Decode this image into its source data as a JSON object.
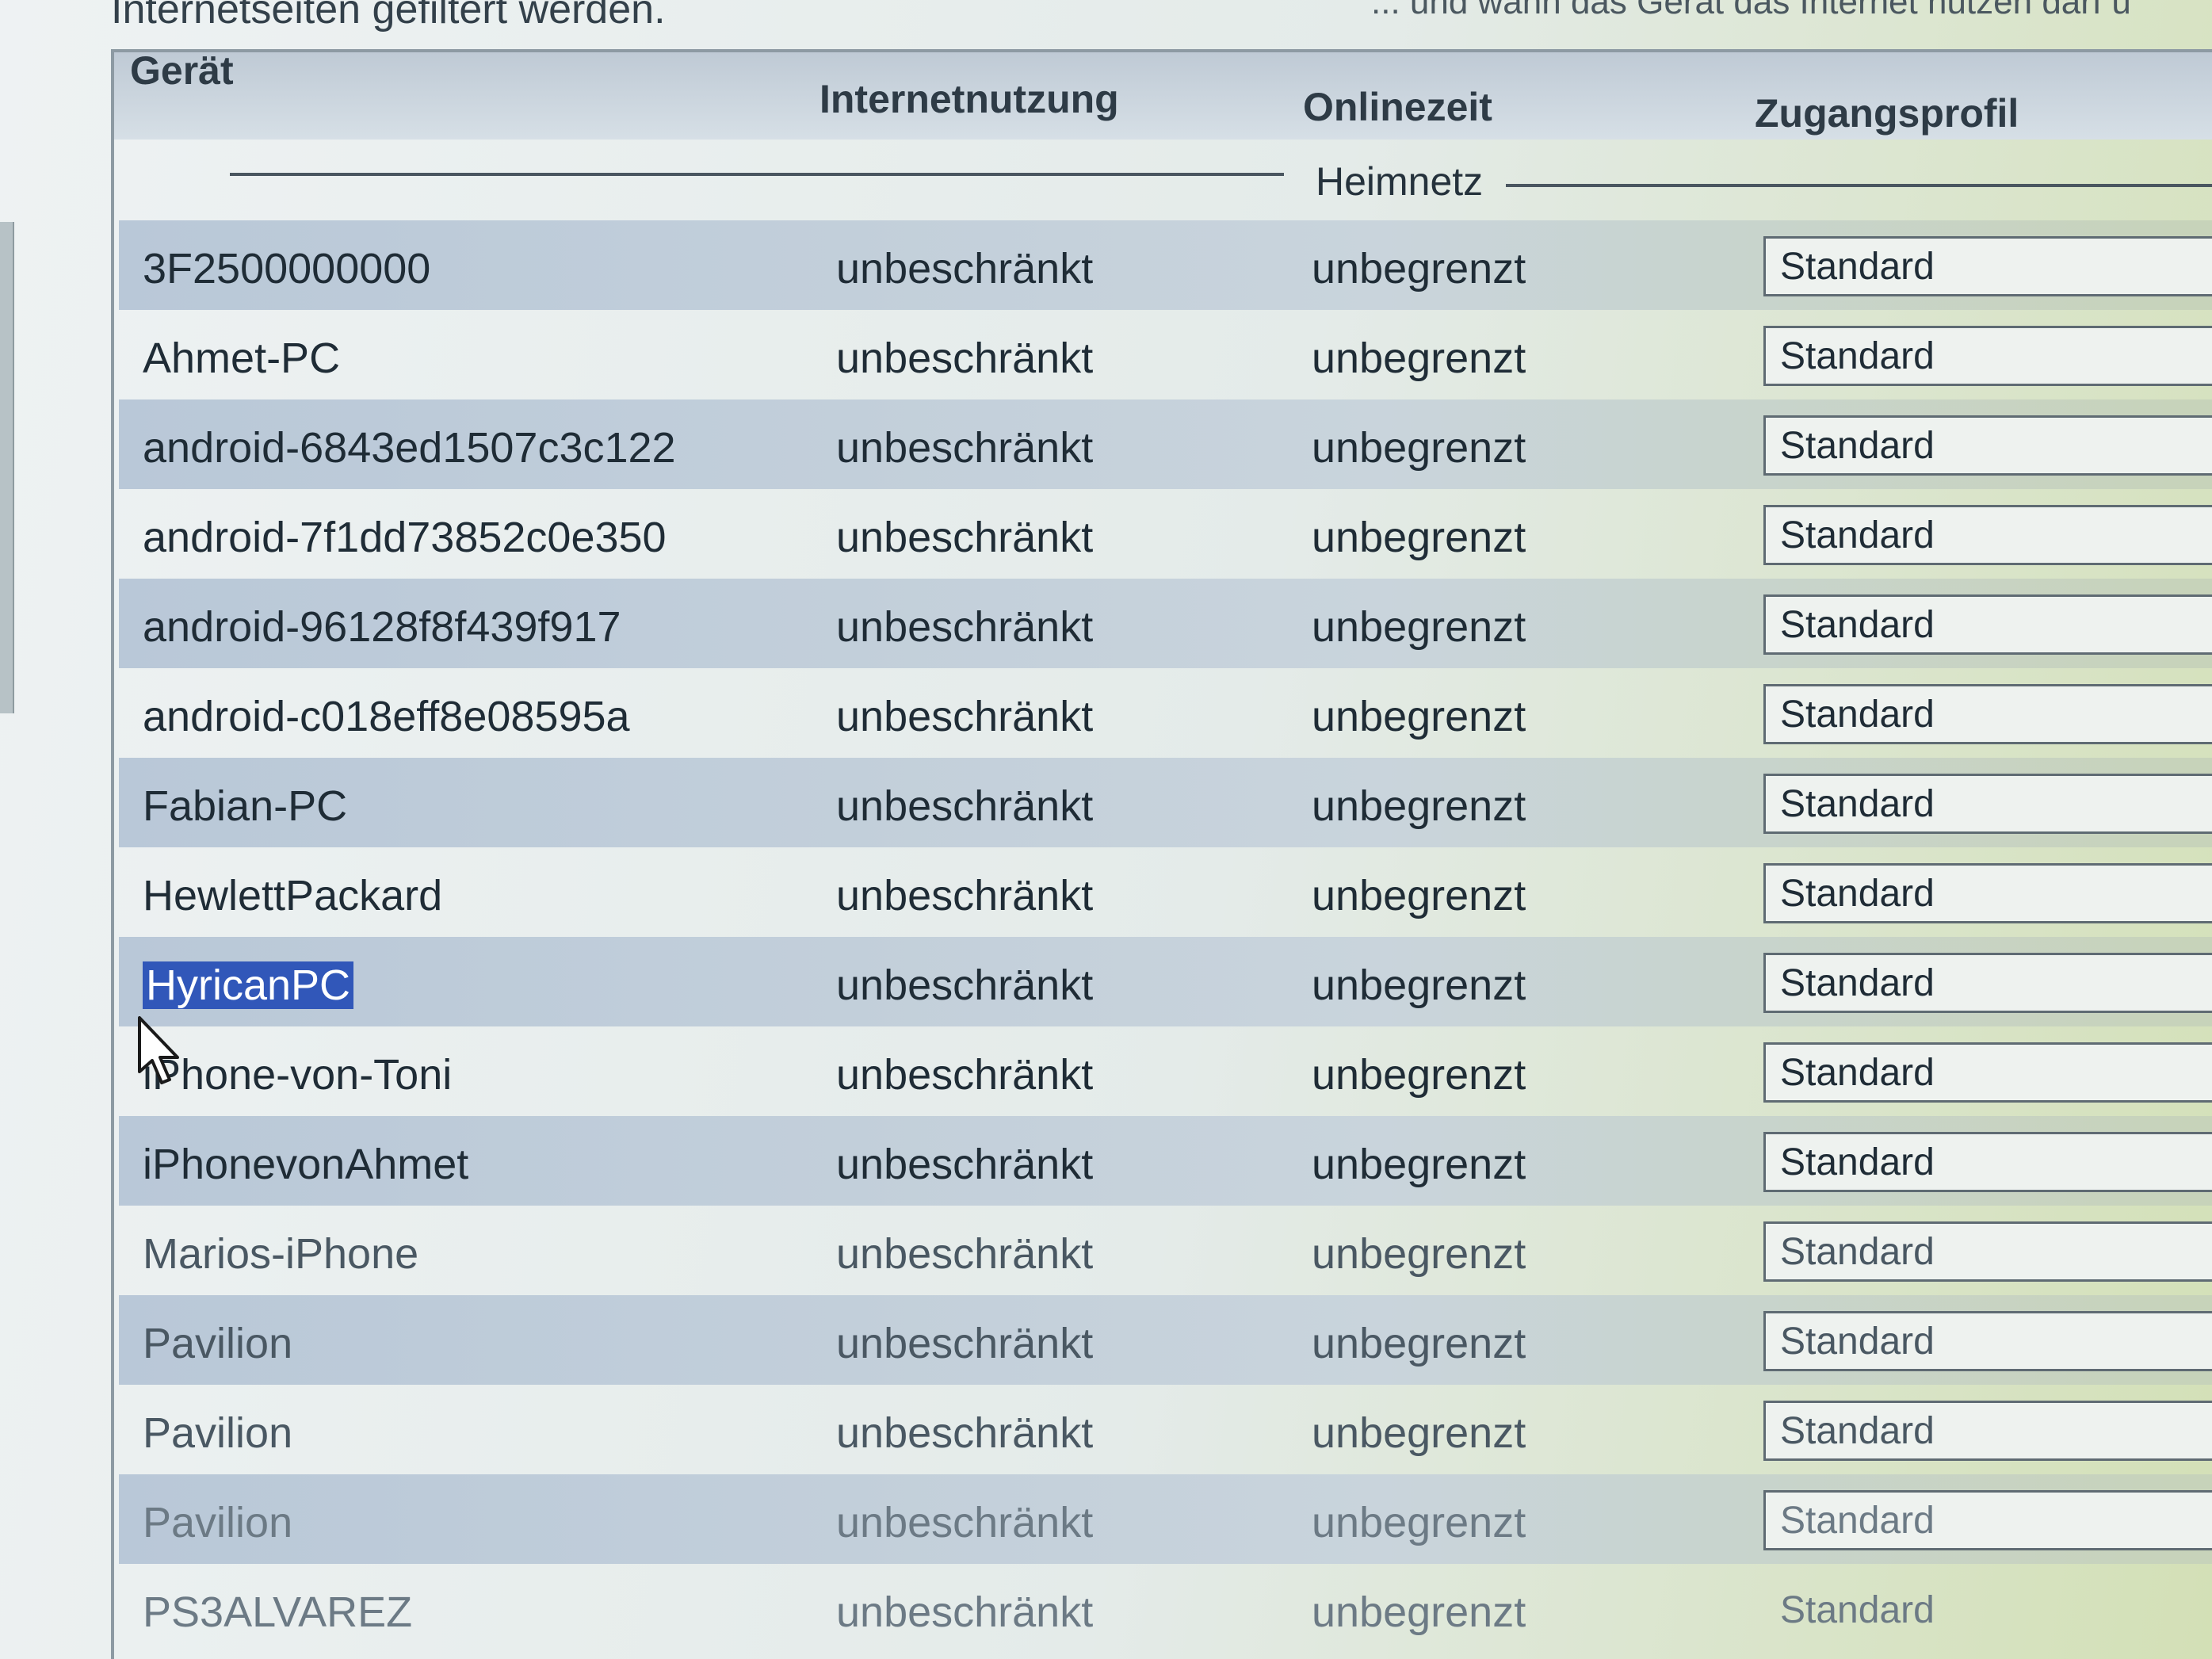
{
  "intro": {
    "left_text": "Internetseiten gefiltert werden.",
    "right_text": "... und wann das Gerät das Internet nutzen darf u"
  },
  "table": {
    "headers": {
      "device": "Gerät",
      "usage": "Internetnutzung",
      "online_time": "Onlinezeit",
      "profile": "Zugangsprofil"
    },
    "group_label": "Heimnetz",
    "rows": [
      {
        "device": "3F2500000000",
        "usage": "unbeschränkt",
        "online_time": "unbegrenzt",
        "profile": "Standard"
      },
      {
        "device": "Ahmet-PC",
        "usage": "unbeschränkt",
        "online_time": "unbegrenzt",
        "profile": "Standard"
      },
      {
        "device": "android-6843ed1507c3c122",
        "usage": "unbeschränkt",
        "online_time": "unbegrenzt",
        "profile": "Standard"
      },
      {
        "device": "android-7f1dd73852c0e350",
        "usage": "unbeschränkt",
        "online_time": "unbegrenzt",
        "profile": "Standard"
      },
      {
        "device": "android-96128f8f439f917",
        "usage": "unbeschränkt",
        "online_time": "unbegrenzt",
        "profile": "Standard"
      },
      {
        "device": "android-c018eff8e08595a",
        "usage": "unbeschränkt",
        "online_time": "unbegrenzt",
        "profile": "Standard"
      },
      {
        "device": "Fabian-PC",
        "usage": "unbeschränkt",
        "online_time": "unbegrenzt",
        "profile": "Standard"
      },
      {
        "device": "HewlettPackard",
        "usage": "unbeschränkt",
        "online_time": "unbegrenzt",
        "profile": "Standard"
      },
      {
        "device": "HyricanPC",
        "usage": "unbeschränkt",
        "online_time": "unbegrenzt",
        "profile": "Standard"
      },
      {
        "device": "iPhone-von-Toni",
        "usage": "unbeschränkt",
        "online_time": "unbegrenzt",
        "profile": "Standard"
      },
      {
        "device": "iPhonevonAhmet",
        "usage": "unbeschränkt",
        "online_time": "unbegrenzt",
        "profile": "Standard"
      },
      {
        "device": "Marios-iPhone",
        "usage": "unbeschränkt",
        "online_time": "unbegrenzt",
        "profile": "Standard"
      },
      {
        "device": "Pavilion",
        "usage": "unbeschränkt",
        "online_time": "unbegrenzt",
        "profile": "Standard"
      },
      {
        "device": "Pavilion",
        "usage": "unbeschränkt",
        "online_time": "unbegrenzt",
        "profile": "Standard"
      },
      {
        "device": "Pavilion",
        "usage": "unbeschränkt",
        "online_time": "unbegrenzt",
        "profile": "Standard"
      },
      {
        "device": "PS3ALVAREZ",
        "usage": "unbeschränkt",
        "online_time": "unbegrenzt",
        "profile": "Standard"
      }
    ]
  },
  "selection": {
    "selected_device": "HyricanPC"
  },
  "colors": {
    "header_bg": "#bfcad5",
    "alt_row_bg": "#b9c8d8",
    "selection_bg": "#3157b9"
  }
}
